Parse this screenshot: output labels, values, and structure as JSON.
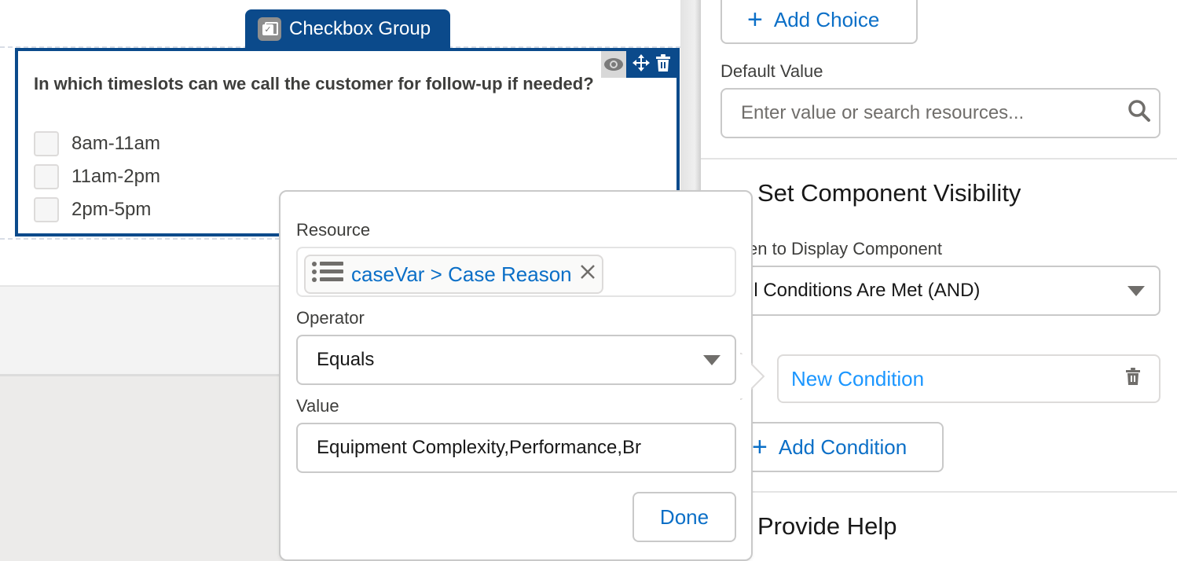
{
  "canvas": {
    "component_tab": {
      "label": "Checkbox Group",
      "icon": "checkbox-group-icon"
    },
    "component_actions": [
      "eye-icon",
      "move-icon",
      "trash-icon"
    ],
    "question": "In which timeslots can we call the customer for follow-up if needed?",
    "options": [
      {
        "label": "8am-11am",
        "checked": false
      },
      {
        "label": "11am-2pm",
        "checked": false
      },
      {
        "label": "2pm-5pm",
        "checked": false
      }
    ],
    "colors": {
      "selected_border": "#0b4a8b"
    }
  },
  "properties": {
    "add_choice_label": "Add Choice",
    "default_value": {
      "label": "Default Value",
      "placeholder": "Enter value or search resources..."
    },
    "visibility": {
      "title": "Set Component Visibility",
      "when_label": "en to Display Component",
      "when_value": "ll Conditions Are Met (AND)",
      "conditions": [
        {
          "label": "New Condition"
        }
      ],
      "add_condition_label": "Add Condition"
    },
    "help_title": "Provide Help"
  },
  "popover": {
    "resource_label": "Resource",
    "resource_value": "caseVar > Case Reason",
    "operator_label": "Operator",
    "operator_value": "Equals",
    "value_label": "Value",
    "value_value": "Equipment Complexity,Performance,Br",
    "done_label": "Done"
  },
  "colors": {
    "link_blue": "#0b6fc7",
    "brand_navy": "#0b4a8b",
    "border_gray": "#c9c9c9"
  }
}
